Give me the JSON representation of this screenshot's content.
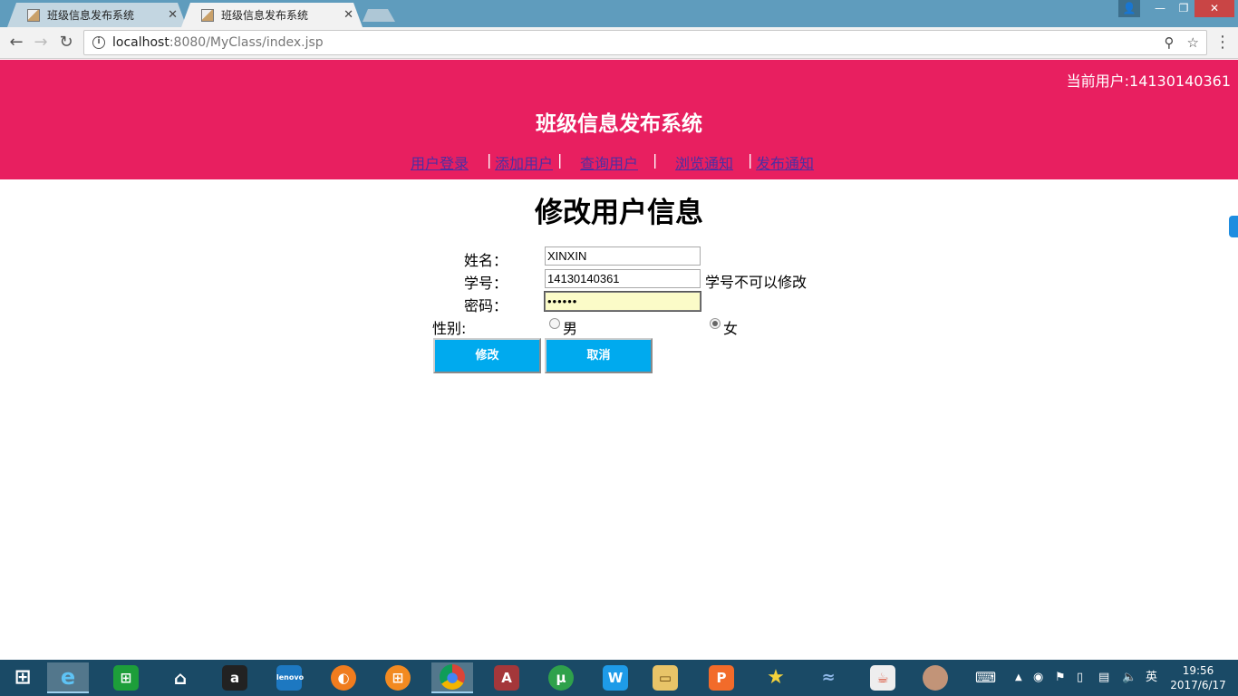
{
  "browser": {
    "tabs": [
      {
        "title": "班级信息发布系统",
        "state": "inactive"
      },
      {
        "title": "班级信息发布系统",
        "state": "active"
      }
    ],
    "address": {
      "host": "localhost",
      "rest": ":8080/MyClass/index.jsp"
    }
  },
  "header": {
    "current_user": "当前用户:14130140361",
    "site_title": "班级信息发布系统",
    "nav": [
      "用户登录",
      "添加用户",
      "查询用户",
      "浏览通知",
      "发布通知"
    ],
    "separator": "|",
    "bg_color": "#e81f60",
    "link_color": "#4b2fa2"
  },
  "form": {
    "heading": "修改用户信息",
    "name_label": "姓名：",
    "name_value": "XINXIN",
    "id_label": "学号：",
    "id_value": "14130140361",
    "id_note": "学号不可以修改",
    "password_label": "密码：",
    "password_value": "••••••",
    "gender_label": "性别:",
    "gender_options": [
      "男",
      "女"
    ],
    "gender_selected": "女",
    "submit_label": "修改",
    "cancel_label": "取消",
    "button_color": "#00aaee"
  },
  "taskbar": {
    "apps": [
      "windows-start-icon",
      "internet-explorer-icon",
      "store-icon",
      "home-icon",
      "amazon-icon",
      "lenovo-icon",
      "firefox-like-icon",
      "apps-grid-icon",
      "chrome-icon",
      "access-icon",
      "utorrent-icon",
      "wps-icon",
      "file-explorer-icon",
      "wps-presentation-icon",
      "star-app-icon",
      "dolphin-icon",
      "java-icon",
      "avatar-photo-icon"
    ],
    "ime": "英",
    "time": "19:56",
    "date": "2017/6/17"
  }
}
